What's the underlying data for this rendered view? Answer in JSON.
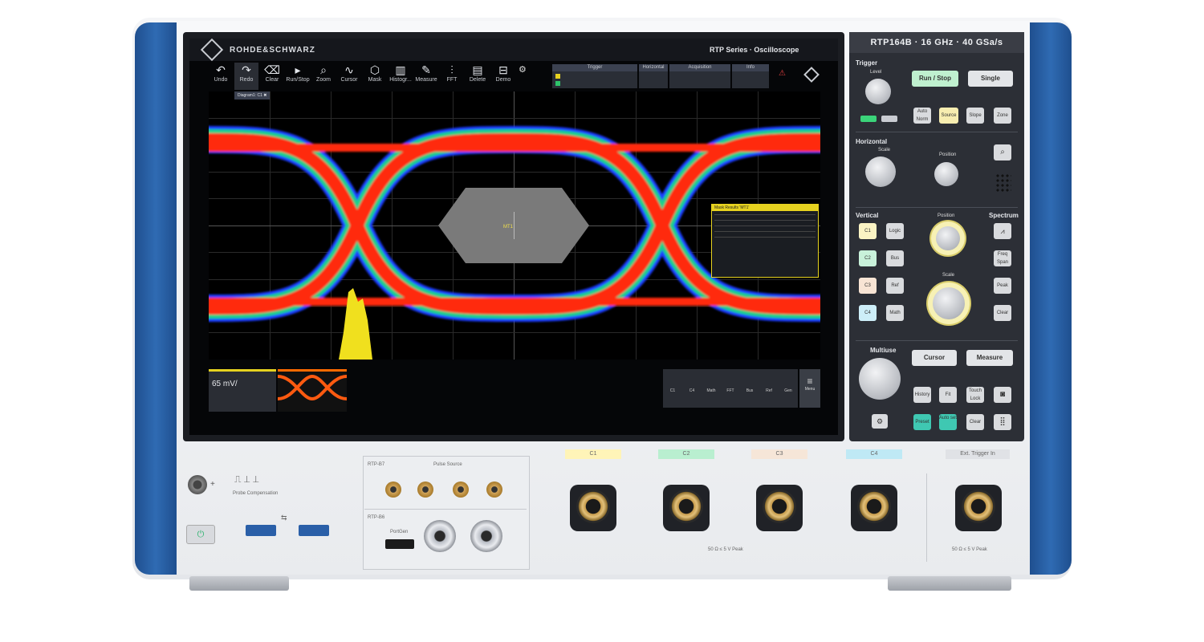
{
  "screen": {
    "brand": "ROHDE&SCHWARZ",
    "series": "RTP Series · Oscilloscope",
    "toolbar": [
      "Undo",
      "Redo",
      "Clear",
      "Run/Stop",
      "Zoom",
      "Cursor",
      "Mask",
      "Histogr...",
      "Measure",
      "FFT",
      "Delete",
      "Demo"
    ],
    "trigger_label": "Trigger",
    "horizontal_label": "Horizontal",
    "acquisition_label": "Acquisition",
    "info_label": "Info",
    "diagram_tab": "Diagram1: C1",
    "mask_label": "MT1",
    "mask_results_title": "Mask Results 'MT1'",
    "channel_value": "65 mV/",
    "right_menu": [
      "C1",
      "C4",
      "Math",
      "FFT",
      "Bus",
      "Ref",
      "Gen"
    ],
    "menu_label": "Menu"
  },
  "panel": {
    "model": "RTP164B · 16 GHz · 40 GSa/s",
    "trigger": "Trigger",
    "level": "Level",
    "run_stop": "Run / Stop",
    "single": "Single",
    "auto_norm": "Auto Norm",
    "source": "Source",
    "slope": "Slope",
    "zone": "Zone",
    "horizontal": "Horizontal",
    "scale": "Scale",
    "position": "Position",
    "vertical": "Vertical",
    "spectrum": "Spectrum",
    "logic": "Logic",
    "bus": "Bus",
    "ref": "Ref",
    "math": "Math",
    "ch_buttons": [
      "C1",
      "C2",
      "C3",
      "C4"
    ],
    "freq_span": "Freq Span",
    "peak": "Peak",
    "clear": "Clear",
    "multiuse": "Multiuse",
    "cursor": "Cursor",
    "measure": "Measure",
    "history": "History",
    "fit": "Fit",
    "touch_lock": "Touch Lock",
    "preset": "Preset",
    "auto_set": "Auto set",
    "clear2": "Clear"
  },
  "front": {
    "probe_comp": "Probe Compensation",
    "pulse_source": "Pulse Source",
    "rtp_b7": "RTP-B7",
    "rtp_b6": "RTP-B6",
    "pwrgen": "PortGen",
    "ch_tabs": [
      "C1",
      "C2",
      "C3",
      "C4",
      "Ext. Trigger In"
    ],
    "ch_colors": [
      "#fff4b8",
      "#b9efd0",
      "#f6e6d8",
      "#bfe9f5",
      "#e0e2e6"
    ],
    "warn": "50 Ω ≤ 5 V Peak"
  }
}
